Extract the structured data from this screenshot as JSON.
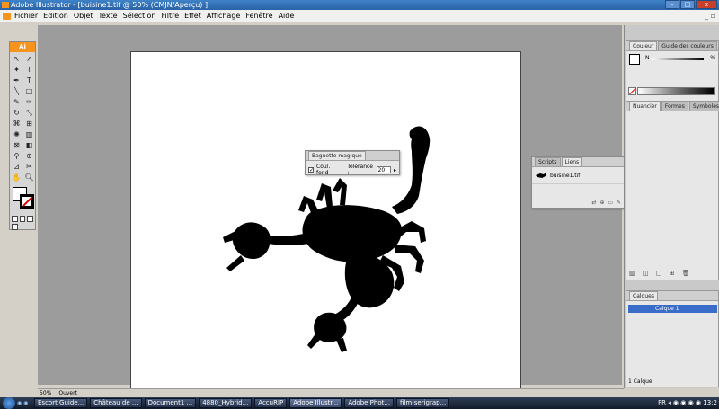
{
  "window": {
    "title": "Adobe Illustrator - [buisine1.tif @ 50% (CMJN/Aperçu) ]"
  },
  "menubar": {
    "items": [
      "Fichier",
      "Edition",
      "Objet",
      "Texte",
      "Sélection",
      "Filtre",
      "Effet",
      "Affichage",
      "Fenêtre",
      "Aide"
    ]
  },
  "toolbox": {
    "logo": "Ai"
  },
  "magic_wand": {
    "tab": "Baguette magique",
    "checkbox_label": "Coul. fond",
    "tolerance_label": "Tolérance :",
    "tolerance_value": "20"
  },
  "links_panel": {
    "tabs": [
      "Scripts",
      "Liens"
    ],
    "file": "buisine1.tif"
  },
  "color_panel": {
    "tabs": [
      "Couleur",
      "Guide des couleurs"
    ],
    "channel": "N",
    "percent": "%"
  },
  "swatches_panel": {
    "tabs": [
      "Nuancier",
      "Formes",
      "Symboles"
    ]
  },
  "layers_panel": {
    "tab": "Calques",
    "layer_name": "Calque 1",
    "footer": "1 Calque"
  },
  "statusbar": {
    "zoom": "50%",
    "mode": "Ouvert"
  },
  "taskbar": {
    "tasks": [
      "Escort Guide...",
      "Château de ...",
      "Document1 ...",
      "4880_Hybrid...",
      "AccuRIP",
      "Adobe Illustr...",
      "Adobe Phot...",
      "film-serigrap..."
    ],
    "lang": "FR",
    "clock": "13:2"
  },
  "colors": {
    "accent": "#f7941d",
    "selection": "#3a6cc9"
  }
}
